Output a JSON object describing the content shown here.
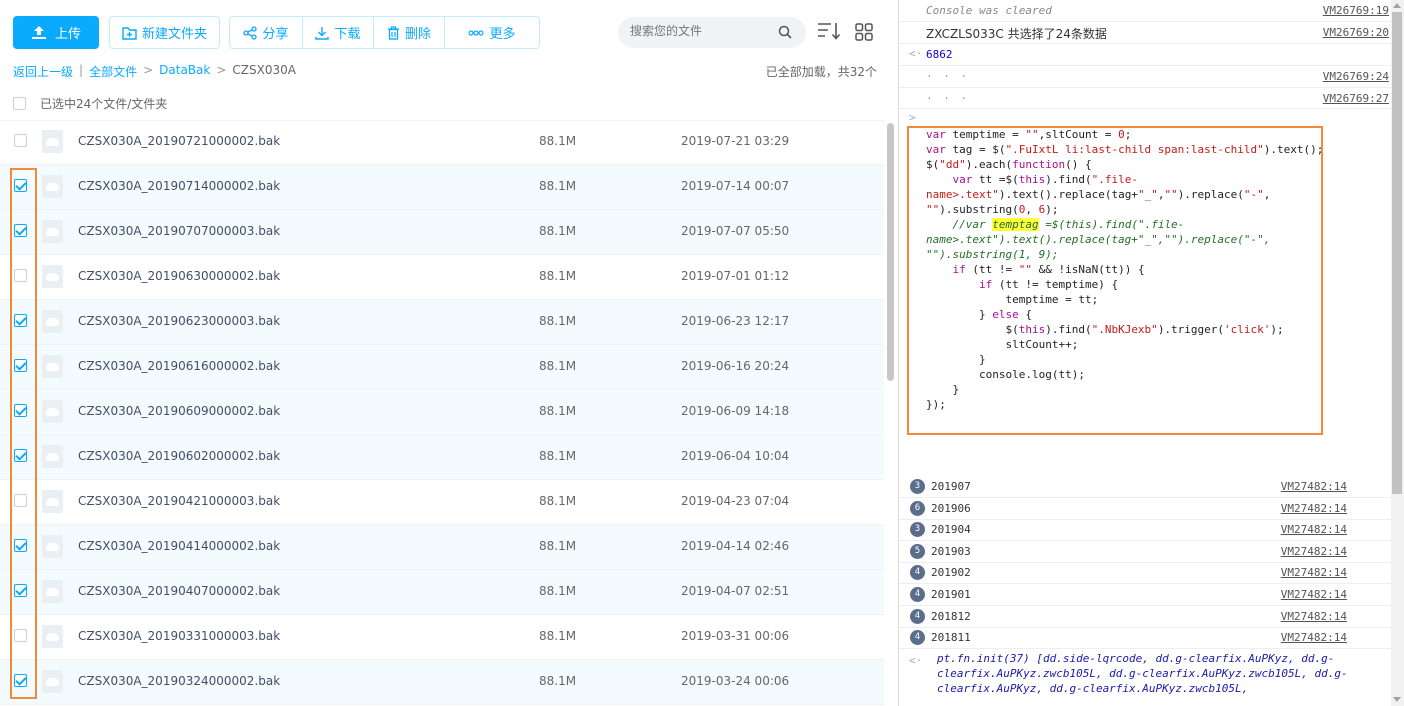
{
  "toolbar": {
    "upload": "上传",
    "new_folder": "新建文件夹",
    "share": "分享",
    "download": "下载",
    "delete": "删除",
    "more": "更多",
    "search_placeholder": "搜索您的文件"
  },
  "breadcrumb": {
    "back": "返回上一级",
    "all": "全部文件",
    "folder": "DataBak",
    "current": "CZSX030A"
  },
  "loaded_text": "已全部加载，共32个",
  "selection_text": "已选中24个文件/文件夹",
  "files": [
    {
      "name": "CZSX030A_20190721000002.bak",
      "size": "88.1M",
      "date": "2019-07-21 03:29",
      "checked": false
    },
    {
      "name": "CZSX030A_20190714000002.bak",
      "size": "88.1M",
      "date": "2019-07-14 00:07",
      "checked": true
    },
    {
      "name": "CZSX030A_20190707000003.bak",
      "size": "88.1M",
      "date": "2019-07-07 05:50",
      "checked": true
    },
    {
      "name": "CZSX030A_20190630000002.bak",
      "size": "88.1M",
      "date": "2019-07-01 01:12",
      "checked": false
    },
    {
      "name": "CZSX030A_20190623000003.bak",
      "size": "88.1M",
      "date": "2019-06-23 12:17",
      "checked": true
    },
    {
      "name": "CZSX030A_20190616000002.bak",
      "size": "88.1M",
      "date": "2019-06-16 20:24",
      "checked": true
    },
    {
      "name": "CZSX030A_20190609000002.bak",
      "size": "88.1M",
      "date": "2019-06-09 14:18",
      "checked": true
    },
    {
      "name": "CZSX030A_20190602000002.bak",
      "size": "88.1M",
      "date": "2019-06-04 10:04",
      "checked": true
    },
    {
      "name": "CZSX030A_20190421000003.bak",
      "size": "88.1M",
      "date": "2019-04-23 07:04",
      "checked": false
    },
    {
      "name": "CZSX030A_20190414000002.bak",
      "size": "88.1M",
      "date": "2019-04-14 02:46",
      "checked": true
    },
    {
      "name": "CZSX030A_20190407000002.bak",
      "size": "88.1M",
      "date": "2019-04-07 02:51",
      "checked": true
    },
    {
      "name": "CZSX030A_20190331000003.bak",
      "size": "88.1M",
      "date": "2019-03-31 00:06",
      "checked": false
    },
    {
      "name": "CZSX030A_20190324000002.bak",
      "size": "88.1M",
      "date": "2019-03-24 00:06",
      "checked": true
    }
  ],
  "console": {
    "cleared": "Console was cleared",
    "cleared_src": "VM26769:19",
    "msg1": "ZXCZLS033C 共选择了24条数据",
    "msg1_src": "VM26769:20",
    "result": "6862",
    "blur1_src": "VM26769:24",
    "blur2_src": "VM26769:27",
    "groups": [
      {
        "count": "3",
        "value": "201907",
        "src": "VM27482:14"
      },
      {
        "count": "6",
        "value": "201906",
        "src": "VM27482:14"
      },
      {
        "count": "3",
        "value": "201904",
        "src": "VM27482:14"
      },
      {
        "count": "5",
        "value": "201903",
        "src": "VM27482:14"
      },
      {
        "count": "4",
        "value": "201902",
        "src": "VM27482:14"
      },
      {
        "count": "4",
        "value": "201901",
        "src": "VM27482:14"
      },
      {
        "count": "4",
        "value": "201812",
        "src": "VM27482:14"
      },
      {
        "count": "4",
        "value": "201811",
        "src": "VM27482:14"
      }
    ],
    "object_text": "pt.fn.init(37) [dd.side-lqrcode, dd.g-clearfix.AuPKyz, dd.g-clearfix.AuPKyz.zwcb105L, dd.g-clearfix.AuPKyz.zwcb105L, dd.g-clearfix.AuPKyz, dd.g-clearfix.AuPKyz.zwcb105L,"
  },
  "colors": {
    "accent": "#09aaff",
    "highlight": "#f08a3d"
  }
}
